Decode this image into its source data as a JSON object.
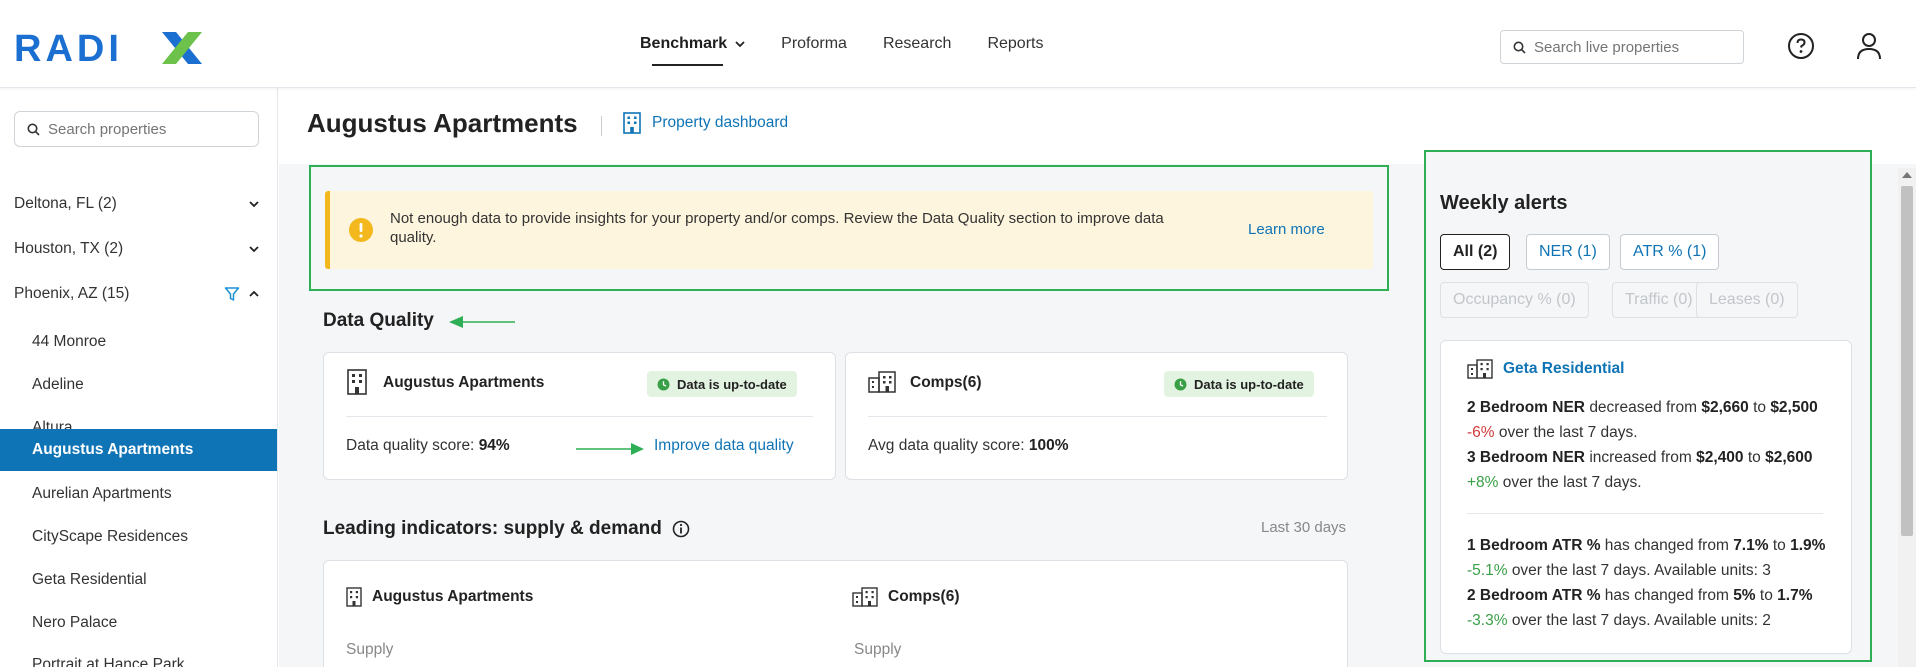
{
  "app": {
    "logo_text": "RADIX",
    "brand_colors": {
      "blue": "#1b6fd1",
      "green": "#6cc24a",
      "accent": "#0f74b6",
      "frame_green": "#2eaf55"
    }
  },
  "nav": {
    "items": [
      {
        "label": "Benchmark",
        "active": true
      },
      {
        "label": "Proforma"
      },
      {
        "label": "Research"
      },
      {
        "label": "Reports"
      }
    ],
    "search_placeholder": "Search live properties"
  },
  "sidebar": {
    "search_placeholder": "Search properties",
    "groups": [
      {
        "label": "Deltona, FL (2)",
        "expanded": false
      },
      {
        "label": "Houston, TX (2)",
        "expanded": false
      },
      {
        "label": "Phoenix, AZ (15)",
        "expanded": true,
        "filter_icon": "funnel-icon"
      }
    ],
    "properties": [
      {
        "label": "44 Monroe"
      },
      {
        "label": "Adeline"
      },
      {
        "label": "Altura"
      },
      {
        "label": "Augustus Apartments",
        "active": true
      },
      {
        "label": "Aurelian Apartments"
      },
      {
        "label": "CityScape Residences"
      },
      {
        "label": "Geta Residential"
      },
      {
        "label": "Nero Palace"
      },
      {
        "label": "Portrait at Hance Park"
      }
    ]
  },
  "header": {
    "title": "Augustus Apartments",
    "dashboard_link": "Property dashboard"
  },
  "alert": {
    "message": "Not enough data to provide insights for your property and/or comps. Review the Data Quality section to improve data quality.",
    "link": "Learn more"
  },
  "data_quality": {
    "title": "Data Quality",
    "property_card": {
      "name": "Augustus Apartments",
      "badge": "Data is up-to-date",
      "score_label": "Data quality score:",
      "score_value": "94%",
      "improve_link": "Improve data quality"
    },
    "comps_card": {
      "name": "Comps(6)",
      "badge": "Data is up-to-date",
      "score_label": "Avg data quality score:",
      "score_value": "100%"
    }
  },
  "leading_indicators": {
    "title": "Leading indicators: supply & demand",
    "range": "Last 30 days",
    "property_name": "Augustus Apartments",
    "comps_name": "Comps(6)",
    "property_sub": "Supply",
    "comps_sub": "Supply"
  },
  "weekly_alerts": {
    "title": "Weekly alerts",
    "filters": [
      {
        "label": "All (2)",
        "state": "active"
      },
      {
        "label": "NER (1)",
        "state": "enabled"
      },
      {
        "label": "ATR % (1)",
        "state": "enabled"
      },
      {
        "label": "Occupancy % (0)",
        "state": "disabled"
      },
      {
        "label": "Traffic (0)",
        "state": "disabled"
      },
      {
        "label": "Leases (0)",
        "state": "disabled"
      }
    ],
    "card": {
      "name": "Geta Residential",
      "ner": [
        {
          "metric": "2 Bedroom NER",
          "verb": "decreased from",
          "from": "$2,660",
          "to_word": "to",
          "to": "$2,500",
          "change": "-6%",
          "tail": "over the last 7 days."
        },
        {
          "metric": "3 Bedroom NER",
          "verb": "increased from",
          "from": "$2,400",
          "to_word": "to",
          "to": "$2,600",
          "change": "+8%",
          "tail": "over the last 7 days."
        }
      ],
      "atr": [
        {
          "metric": "1 Bedroom ATR %",
          "verb": "has changed from",
          "from": "7.1%",
          "to_word": "to",
          "to": "1.9%",
          "change": "-5.1%",
          "tail": "over the last 7 days. Available units: 3"
        },
        {
          "metric": "2 Bedroom ATR %",
          "verb": "has changed from",
          "from": "5%",
          "to_word": "to",
          "to": "1.7%",
          "change": "-3.3%",
          "tail": "over the last 7 days. Available units: 2"
        }
      ]
    }
  }
}
